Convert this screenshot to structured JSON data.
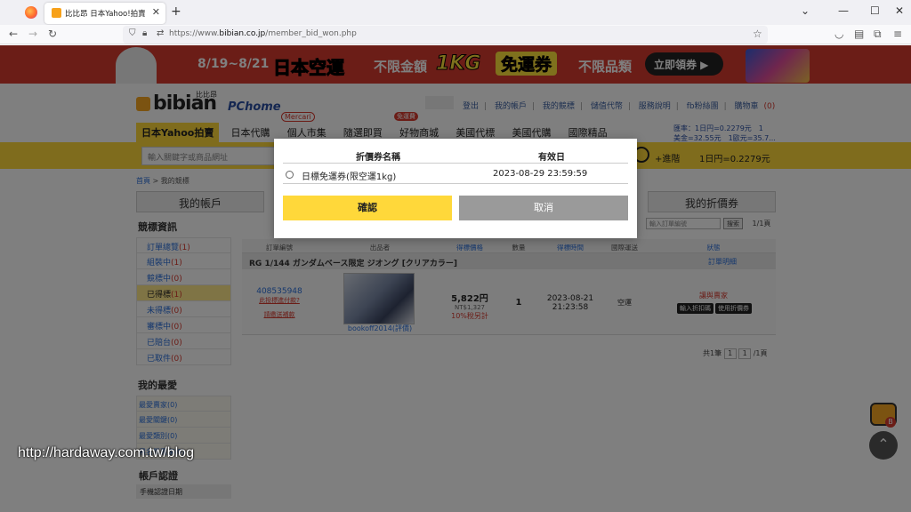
{
  "browser": {
    "tab_title": "比比昂 日本Yahoo!拍賣代標 | ...",
    "url_prefix": "https://www.",
    "url_domain": "bibian.co.jp",
    "url_path": "/member_bid_won.php"
  },
  "banner": {
    "date": "8/19~8/21",
    "main": "日本空運",
    "limit1": "不限金額",
    "weight": "1KG",
    "coupon": "免運券",
    "limit2": "不限品類",
    "cta": "立即領券 ▶"
  },
  "header": {
    "logo": "bibian",
    "logo_sub": "比比昂",
    "logo_partner": "PChome",
    "links": [
      "登出",
      "我的帳戶",
      "我的競標",
      "儲值代幣",
      "服務說明",
      "fb粉絲團",
      "購物車"
    ],
    "cart_count": "(0)",
    "rate_line1": "匯率：1日円=0.2279元　1",
    "rate_line2": "美金=32.55元　1歐元=35.7..."
  },
  "nav": {
    "items": [
      "日本Yahoo拍賣",
      "日本代購",
      "個人市集",
      "隨選即買",
      "好物商城",
      "美國代標",
      "美國代購",
      "國際精品"
    ],
    "badge_mercari": "Mercari",
    "badge_free": "免運費"
  },
  "search": {
    "placeholder": "輸入關鍵字或商品網址",
    "advanced": "+進階",
    "rate": "1日円=0.2279元"
  },
  "breadcrumb": {
    "home": "首頁",
    "sep": " > ",
    "current": "我的競標"
  },
  "sidetabs": {
    "account": "我的帳戶",
    "coupon": "我的折價券"
  },
  "sidebar": {
    "title": "競標資訊",
    "items": [
      {
        "label": "訂單總覽",
        "count": "(1)"
      },
      {
        "label": "組裝中",
        "count": "(1)"
      },
      {
        "label": "競標中",
        "count": "(0)"
      },
      {
        "label": "已得標",
        "count": "(1)"
      },
      {
        "label": "未得標",
        "count": "(0)"
      },
      {
        "label": "審標中",
        "count": "(0)"
      },
      {
        "label": "已賠台",
        "count": "(0)"
      },
      {
        "label": "已取件",
        "count": "(0)"
      }
    ],
    "fav_title": "我的最愛",
    "fav_items": [
      {
        "label": "最愛賣家",
        "count": "(0)"
      },
      {
        "label": "最愛關鍵",
        "count": "(0)"
      },
      {
        "label": "最愛類別",
        "count": "(0)"
      },
      {
        "label": "黑名單賣家",
        "count": "(0)"
      }
    ],
    "acct_title": "帳戶認證",
    "acct_row": "手機認證日期"
  },
  "table_tools": {
    "order_input": "輸入訂單編號",
    "search_btn": "搜索",
    "pages": "1/1頁"
  },
  "table": {
    "headers": [
      "訂單編號",
      "出品者",
      "得標價格",
      "數量",
      "得標時間",
      "國際運送",
      "狀態"
    ],
    "item_title": "RG 1/144 ガンダムベース限定 ジオング [クリアカラー]",
    "detail_link": "訂單明細",
    "order_no": "408535948",
    "order_link1": "此投標進付款?",
    "order_link2": "請繳送補款",
    "seller": "bookoff2014(評價)",
    "price": "5,822円",
    "price_twd": "NT$1,327",
    "tax": "10%稅另計",
    "qty": "1",
    "won_date": "2023-08-21",
    "won_time": "21:23:58",
    "shipping": "空運",
    "status": "讓與賣家",
    "status_btn1": "輸入折扣碼",
    "status_btn2": "使用折價券"
  },
  "pager": {
    "total": "共1筆",
    "page1": "1",
    "page_input": "1",
    "of": "/1頁"
  },
  "watermark": "http://hardaway.com.tw/blog",
  "modal": {
    "col_name": "折價券名稱",
    "col_valid": "有效日",
    "coupon_name": "日標免運券(限空運1kg)",
    "coupon_valid": "2023-08-29 23:59:59",
    "confirm": "確認",
    "cancel": "取消"
  }
}
